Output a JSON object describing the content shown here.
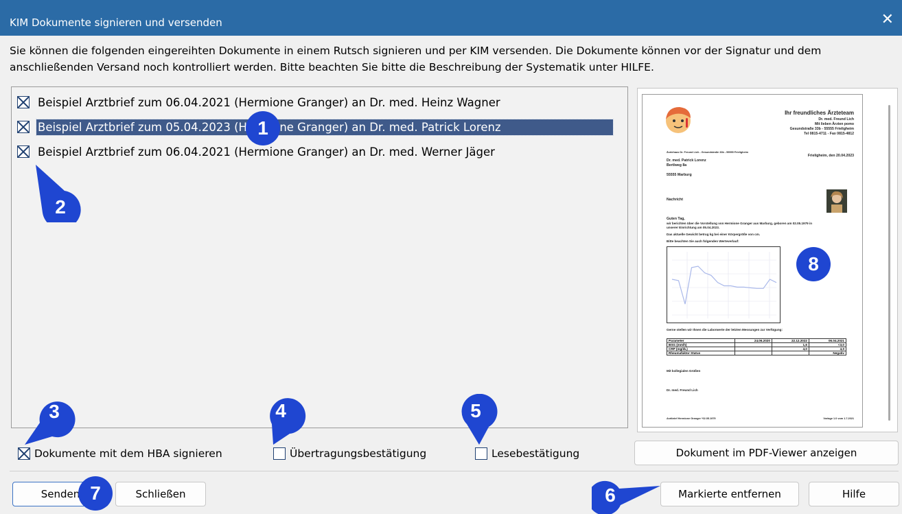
{
  "window": {
    "title": "KIM Dokumente signieren und versenden",
    "close_glyph": "✕"
  },
  "description": "Sie können die folgenden eingereihten Dokumente in einem Rutsch signieren und per KIM versenden. Die Dokumente können vor der Signatur und dem anschließenden Versand noch kontrolliert werden. Bitte beachten Sie bitte die Beschreibung der Systematik unter HILFE.",
  "documents": [
    {
      "label": "Beispiel Arztbrief zum 06.04.2021 (Hermione Granger) an Dr. med. Heinz Wagner",
      "checked": true,
      "selected": false
    },
    {
      "label": "Beispiel Arztbrief zum 05.04.2023 (Hermione Granger) an Dr. med. Patrick Lorenz",
      "checked": true,
      "selected": true
    },
    {
      "label": "Beispiel Arztbrief zum 06.04.2021 (Hermione Granger) an Dr. med. Werner Jäger",
      "checked": true,
      "selected": false
    }
  ],
  "options": {
    "sign_hba": {
      "label": "Dokumente mit dem HBA signieren",
      "checked": true
    },
    "transfer_confirm": {
      "label": "Übertragungsbestätigung",
      "checked": false
    },
    "read_confirm": {
      "label": "Lesebestätigung",
      "checked": false
    }
  },
  "buttons": {
    "pdf_viewer": "Dokument im PDF-Viewer anzeigen",
    "send": "Senden",
    "close": "Schließen",
    "remove_marked": "Markierte entfernen",
    "help": "Hilfe"
  },
  "badges": [
    "1",
    "2",
    "3",
    "4",
    "5",
    "6",
    "7",
    "8"
  ],
  "preview_doc": {
    "team": "Ihr freundliches Ärzteteam",
    "sender_name": "Dr. med. Freund Lich",
    "sender_lines": [
      "Mit lieben Ärzten pomo",
      "Gesundstraße 33b - 55555 Frieligheim",
      "Tel 0815-4711 - Fax 0815-4812"
    ],
    "sender_small": "Ärztehaus Dr. Freund Lich - Gesundstraße 33b - 55555 Frieligheim",
    "date_line": "Frieligheim, den 20.04.2023",
    "recipient": [
      "Dr. med. Patrick Lorenz",
      "Bertlweg 8a",
      "",
      "55555 Marburg"
    ],
    "subject": "Nachricht",
    "greeting": "Guten Tag,",
    "body": [
      "wir berichten über die Vorstellung von Hermione Granger aus Marburg, geboren am 02.05.1979 in",
      "unserer Einrichtung am 05.04.2023.",
      "Das aktuelle Gewicht betrug kg bei einer Körpergröße von cm.",
      "Bitte beachten Sie auch folgenden Werteverlauf:"
    ],
    "lab_intro": "Gerne stellen wir Ihnen die Laborwerte der letzten Messungen zur Verfügung:",
    "lab_header": [
      "Parameter",
      "24.06.2020",
      "22.12.2022",
      "06.04.2021"
    ],
    "lab_rows": [
      [
        "BSG (mm/h)",
        "",
        "1,6",
        "<3,0"
      ],
      [
        "CRP (mg/dL)",
        "",
        "4,0",
        "4,0"
      ],
      [
        "Rheumafaktor Status",
        "",
        "",
        "Negativ"
      ]
    ],
    "closing": "Mit kollegialen Grüßen",
    "signer": "Dr. med. Freund Lich",
    "footer_left": "Arztbrief Hermione Granger *02.05.1979",
    "footer_right": "Vorlage 1.0 vom 1.7.2021",
    "chart": {
      "type": "line",
      "points": [
        60,
        58,
        22,
        78,
        80,
        70,
        66,
        55,
        50,
        50,
        48,
        48,
        47,
        46,
        46,
        60,
        55
      ]
    }
  }
}
